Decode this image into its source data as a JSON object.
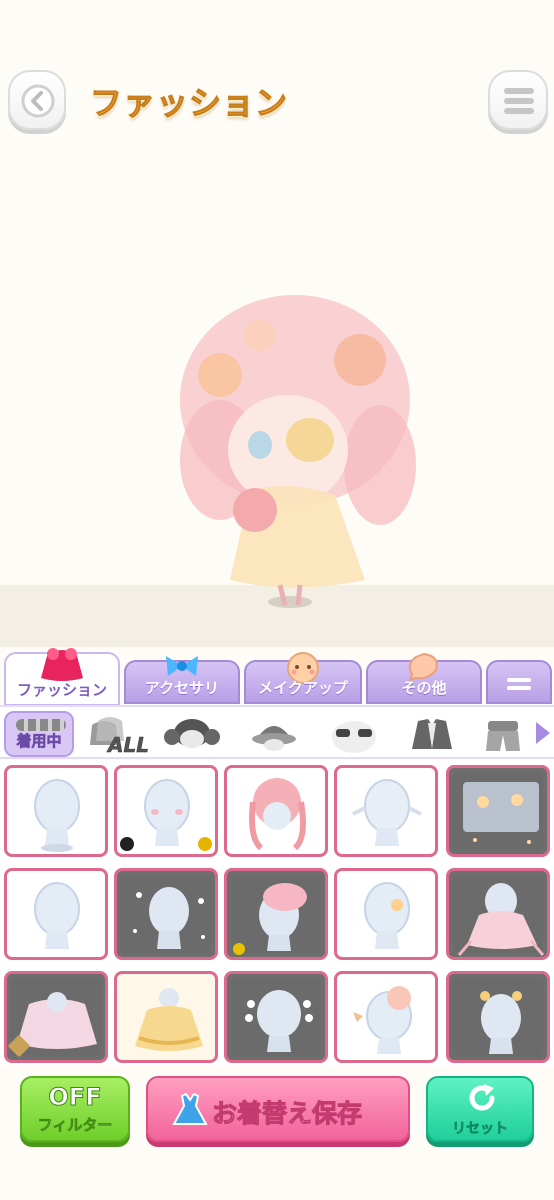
{
  "header": {
    "title": "ファッション",
    "back_icon": "chevron-left-icon",
    "menu_icon": "hamburger-menu-icon"
  },
  "tabs": [
    {
      "label": "ファッション",
      "icon": "dress-icon",
      "active": true
    },
    {
      "label": "アクセサリ",
      "icon": "ribbon-icon",
      "active": false
    },
    {
      "label": "メイクアップ",
      "icon": "face-icon",
      "active": false
    },
    {
      "label": "その他",
      "icon": "bubble-icon",
      "active": false
    },
    {
      "label": "",
      "icon": "more-menu-icon",
      "active": false
    }
  ],
  "subcategories": {
    "wearing_label": "着用中",
    "all_label": "ALL",
    "items": [
      "hairstyle-icon",
      "hat-icon",
      "glasses-icon",
      "jacket-icon",
      "bottoms-icon"
    ],
    "next_icon": "arrow-right-icon"
  },
  "buttons": {
    "filter_line1": "OFF",
    "filter_line2": "フィルター",
    "save_label": "お着替え保存",
    "reset_label": "リセット"
  },
  "colors": {
    "accent_purple": "#b7a0e6",
    "cell_border": "#dd6a8c",
    "title_orange": "#f3a63b"
  }
}
